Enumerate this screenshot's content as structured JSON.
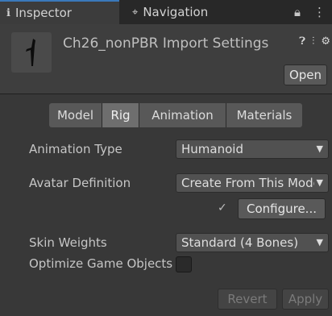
{
  "tabs": {
    "inspector_icon": "info-icon",
    "inspector": "Inspector",
    "navigation_icon": "navigation-icon",
    "navigation": "Navigation",
    "lock_icon": "lock-icon",
    "menu_icon": "kebab-menu-icon"
  },
  "header": {
    "title": "Ch26_nonPBR Import Settings",
    "help_icon": "help-icon",
    "preset_icon": "preset-icon",
    "settings_icon": "gear-icon",
    "open_label": "Open"
  },
  "subtabs": [
    "Model",
    "Rig",
    "Animation",
    "Materials"
  ],
  "selected_subtab": "Rig",
  "fields": {
    "animation_type_label": "Animation Type",
    "animation_type_value": "Humanoid",
    "avatar_definition_label": "Avatar Definition",
    "avatar_definition_value": "Create From This Model",
    "configure_label": "Configure...",
    "skin_weights_label": "Skin Weights",
    "skin_weights_value": "Standard (4 Bones)",
    "optimize_label": "Optimize Game Objects",
    "optimize_checked": false
  },
  "footer": {
    "revert": "Revert",
    "apply": "Apply"
  },
  "colors": {
    "background": "#383838",
    "tab_accent": "#3a79bb"
  }
}
